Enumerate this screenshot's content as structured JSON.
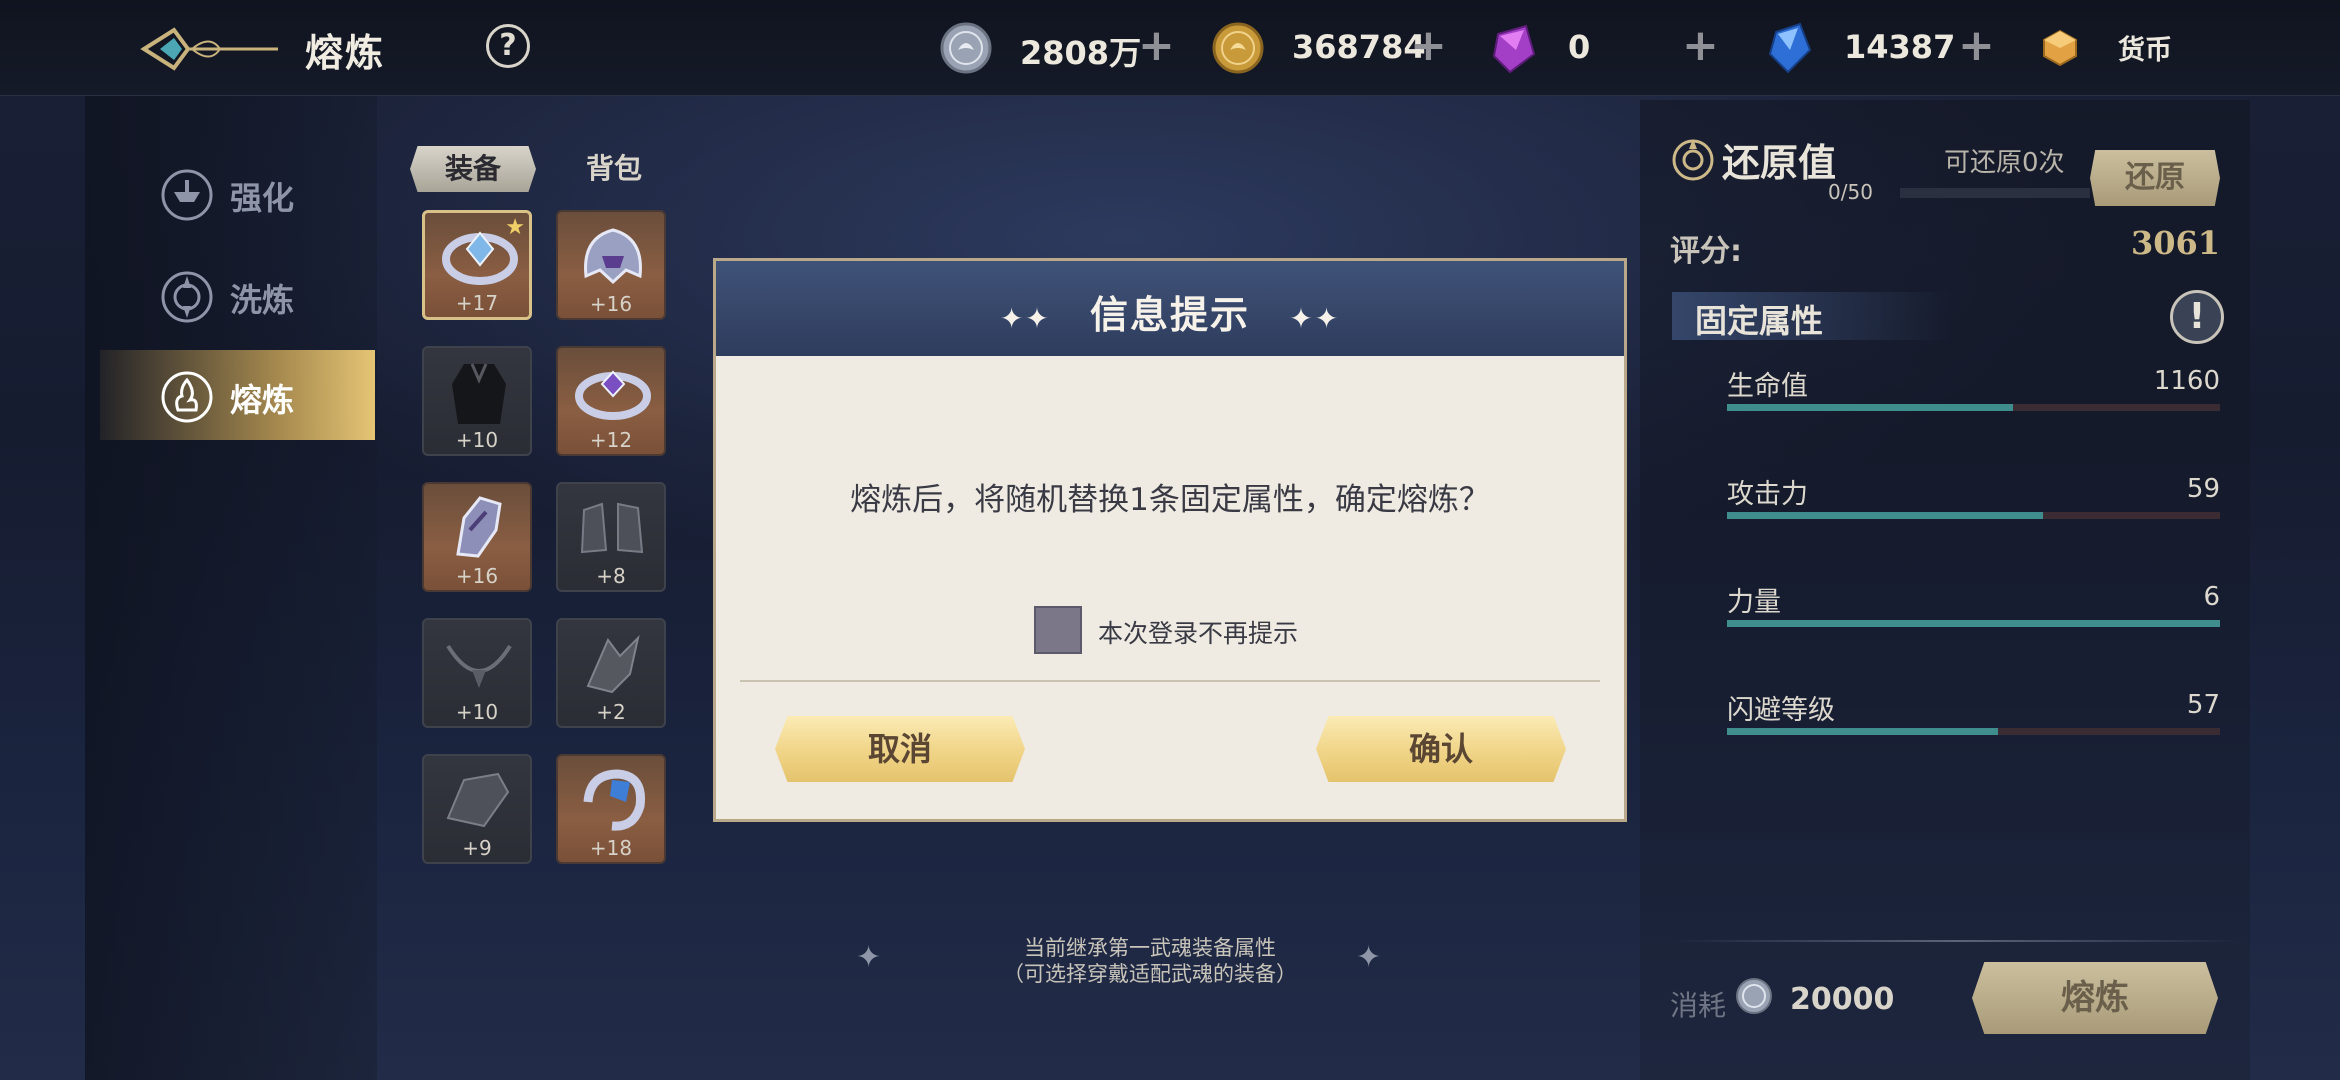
{
  "header": {
    "title": "熔炼",
    "help": "?",
    "currencies": [
      {
        "icon": "silver-coin-icon",
        "value": "2808万"
      },
      {
        "icon": "gold-coin-icon",
        "value": "368784"
      },
      {
        "icon": "purple-crystal-icon",
        "value": "0"
      },
      {
        "icon": "blue-crystal-icon",
        "value": "14387"
      }
    ],
    "currency_icon": "currency-cube-icon",
    "currency_label": "货币"
  },
  "nav": {
    "items": [
      {
        "label": "强化",
        "icon": "enhance-icon"
      },
      {
        "label": "洗炼",
        "icon": "refine-icon"
      },
      {
        "label": "熔炼",
        "icon": "smelt-icon",
        "selected": true
      }
    ]
  },
  "equipment": {
    "tabs": [
      "装备",
      "背包"
    ],
    "active_tab": "装备",
    "slots": [
      {
        "icon": "ring-icon",
        "level": "+17",
        "filled": true,
        "starred": true,
        "selected": true
      },
      {
        "icon": "helmet-icon",
        "level": "+16",
        "filled": true
      },
      {
        "icon": "armor-icon",
        "level": "+10",
        "filled": false
      },
      {
        "icon": "ring-icon",
        "level": "+12",
        "filled": true
      },
      {
        "icon": "gauntlet-icon",
        "level": "+16",
        "filled": true
      },
      {
        "icon": "boots-icon",
        "level": "+8",
        "filled": false
      },
      {
        "icon": "necklace-icon",
        "level": "+10",
        "filled": false
      },
      {
        "icon": "ornament-icon",
        "level": "+2",
        "filled": false
      },
      {
        "icon": "bracer-icon",
        "level": "+9",
        "filled": false
      },
      {
        "icon": "bracelet-icon",
        "level": "+18",
        "filled": true
      }
    ]
  },
  "restore": {
    "title": "还原值",
    "count_text": "可还原0次",
    "progress": "0/50",
    "button": "还原"
  },
  "score": {
    "label": "评分:",
    "value": "3061"
  },
  "fixed_attributes": {
    "label": "固定属性",
    "info": "!",
    "items": [
      {
        "name": "生命值",
        "value": "1160",
        "fill": 0.58
      },
      {
        "name": "攻击力",
        "value": "59",
        "fill": 0.64
      },
      {
        "name": "力量",
        "value": "6",
        "fill": 1.0
      },
      {
        "name": "闪避等级",
        "value": "57",
        "fill": 0.55
      }
    ]
  },
  "cost": {
    "label": "消耗",
    "value": "20000"
  },
  "smelt_button": "熔炼",
  "hint": {
    "line1": "当前继承第一武魂装备属性",
    "line2": "（可选择穿戴适配武魂的装备）"
  },
  "dialog": {
    "title": "信息提示",
    "message": "熔炼后，将随机替换1条固定属性，确定熔炼？",
    "checkbox_label": "本次登录不再提示",
    "cancel": "取消",
    "confirm": "确认"
  },
  "colors": {
    "accent_gold": "#f0d487",
    "bar_fill": "#3f8d8c",
    "bar_track": "#3b2b33",
    "dialog_header": "#3f5278"
  }
}
